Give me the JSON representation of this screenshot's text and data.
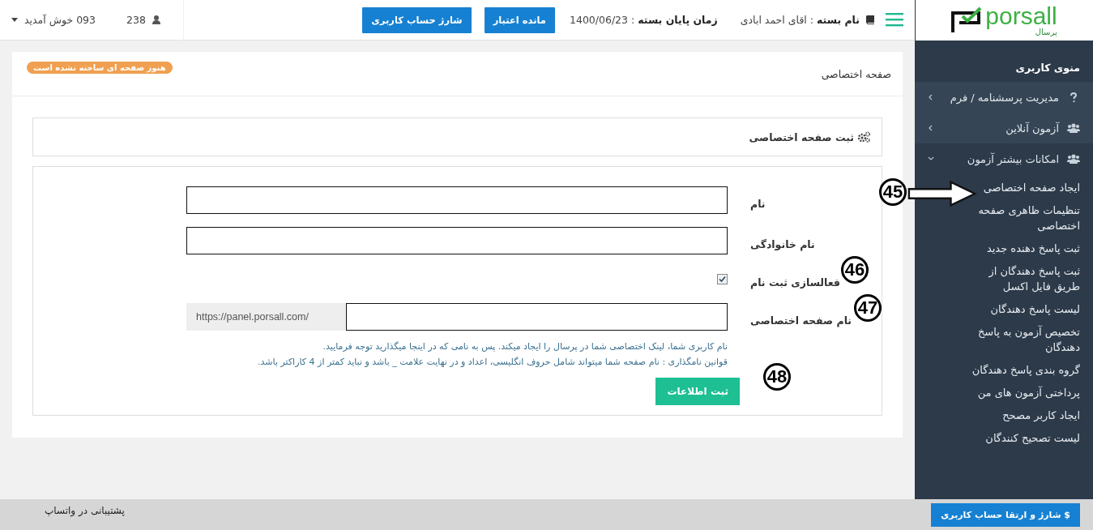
{
  "logo": {
    "brand": "porsall",
    "brand_fa": "پرسال"
  },
  "header": {
    "package": "**نام بسته** : اقای احمد ابادی",
    "end_date": "**زمان پایان بسته** : 1400/06/23",
    "buttons": [
      "مانده اعتبار",
      "شارژ حساب کاربری"
    ],
    "user_count": "238",
    "welcome": "093 خوش آمدید"
  },
  "sidebar": {
    "title": "منوی کاربری",
    "items": [
      {
        "label": "مدیریت پرسشنامه / فرم",
        "expanded": false
      },
      {
        "label": "آزمون آنلاین",
        "expanded": false
      },
      {
        "label": "امکانات بیشتر آزمون",
        "expanded": true,
        "children": [
          {
            "label": "ایجاد صفحه اختصاصی"
          },
          {
            "label": "تنظیمات ظاهری صفحه اختصاصی"
          },
          {
            "label": "ثبت پاسخ دهنده جدید"
          },
          {
            "label": "ثبت پاسخ دهندگان از طریق فایل اکسل"
          },
          {
            "label": "لیست پاسخ دهندگان"
          },
          {
            "label": "تخصیص آزمون به پاسخ دهندگان"
          },
          {
            "label": "گروه بندی پاسخ دهندگان"
          },
          {
            "label": "پرداختی آزمون های من"
          },
          {
            "label": "ایجاد کاربر مصحح"
          },
          {
            "label": "لیست تصحیح کنندگان"
          }
        ]
      }
    ]
  },
  "page": {
    "title": "صفحه اختصاصی",
    "badge": "هنوز صفحه ای ساخته نشده است",
    "panel_title": "ثبت صفحه اختصاصی",
    "fields": [
      {
        "kind": "text",
        "label": "نام"
      },
      {
        "kind": "text",
        "label": "نام خانوادگی"
      },
      {
        "kind": "checkbox",
        "label": "فعالسازی ثبت نام",
        "checked": true
      },
      {
        "kind": "url",
        "label": "نام صفحه اختصاصی",
        "prefix": "https://panel.porsall.com/"
      }
    ],
    "help": [
      "نام کاربری شما، لینک اختصاصی شما در پرسال را ایجاد میکند. پس به نامی که در اینجا میگذارید توجه فرمایید.",
      "قوانین نامگذاری : نام صفحه شما میتواند شامل حروف انگلیسی، اعداد و در نهایت علامت _ باشد و نباید کمتر از 4 کاراکتر باشد."
    ],
    "submit": "ثبت اطلاعات"
  },
  "footer": {
    "support": "پشتیبانی در واتساپ",
    "upgrade": "$ شارژ و ارتقا حساب کاربری"
  },
  "callouts": [
    "45",
    "46",
    "47",
    "48"
  ]
}
